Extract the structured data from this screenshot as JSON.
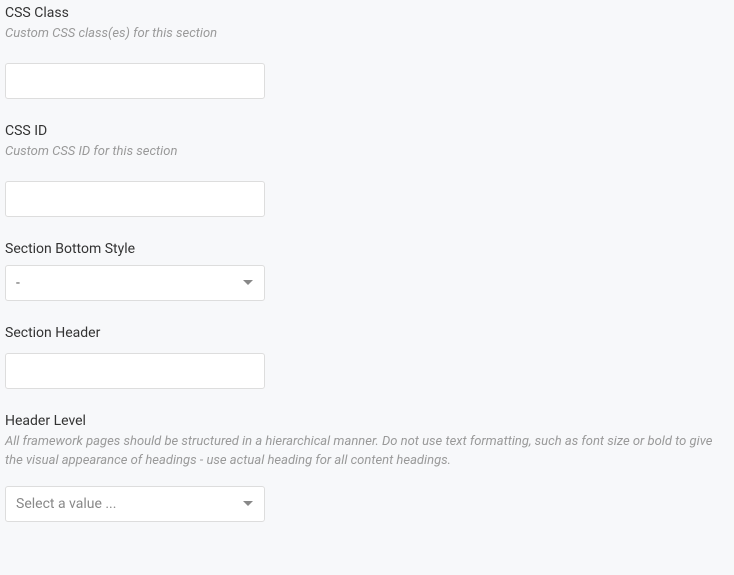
{
  "fields": {
    "cssClass": {
      "label": "CSS Class",
      "hint": "Custom CSS class(es) for this section",
      "value": ""
    },
    "cssId": {
      "label": "CSS ID",
      "hint": "Custom CSS ID for this section",
      "value": ""
    },
    "sectionBottomStyle": {
      "label": "Section Bottom Style",
      "selected": "-"
    },
    "sectionHeader": {
      "label": "Section Header",
      "value": ""
    },
    "headerLevel": {
      "label": "Header Level",
      "hint": "All framework pages should be structured in a hierarchical manner. Do not use text formatting, such as font size or bold to give the visual appearance of headings - use actual heading for all content headings.",
      "placeholder": "Select a value ..."
    }
  }
}
